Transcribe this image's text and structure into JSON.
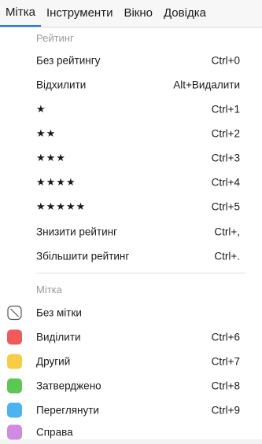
{
  "menubar": {
    "items": [
      "Мітка",
      "Інструменти",
      "Вікно",
      "Довідка"
    ]
  },
  "menu": {
    "rating_header": "Рейтинг",
    "rating_items": [
      {
        "label": "Без рейтингу",
        "shortcut": "Ctrl+0"
      },
      {
        "label": "Відхилити",
        "shortcut": "Alt+Видалити"
      },
      {
        "label": "★",
        "shortcut": "Ctrl+1"
      },
      {
        "label": "★★",
        "shortcut": "Ctrl+2"
      },
      {
        "label": "★★★",
        "shortcut": "Ctrl+3"
      },
      {
        "label": "★★★★",
        "shortcut": "Ctrl+4"
      },
      {
        "label": "★★★★★",
        "shortcut": "Ctrl+5"
      },
      {
        "label": "Знизити рейтинг",
        "shortcut": "Ctrl+,"
      },
      {
        "label": "Збільшити рейтинг",
        "shortcut": "Ctrl+."
      }
    ],
    "label_header": "Мітка",
    "label_items": [
      {
        "label": "Без мітки",
        "shortcut": "",
        "icon": "no-label-icon"
      },
      {
        "label": "Виділити",
        "shortcut": "Ctrl+6",
        "color": "#f05a5a"
      },
      {
        "label": "Другий",
        "shortcut": "Ctrl+7",
        "color": "#f5cd47"
      },
      {
        "label": "Затверджено",
        "shortcut": "Ctrl+8",
        "color": "#5cc853"
      },
      {
        "label": "Переглянути",
        "shortcut": "Ctrl+9",
        "color": "#4ab3f0"
      },
      {
        "label": "Справа",
        "shortcut": "",
        "color": "#cf8be0"
      }
    ]
  },
  "colors": {
    "active_menu_underline": "#1a73e8"
  }
}
